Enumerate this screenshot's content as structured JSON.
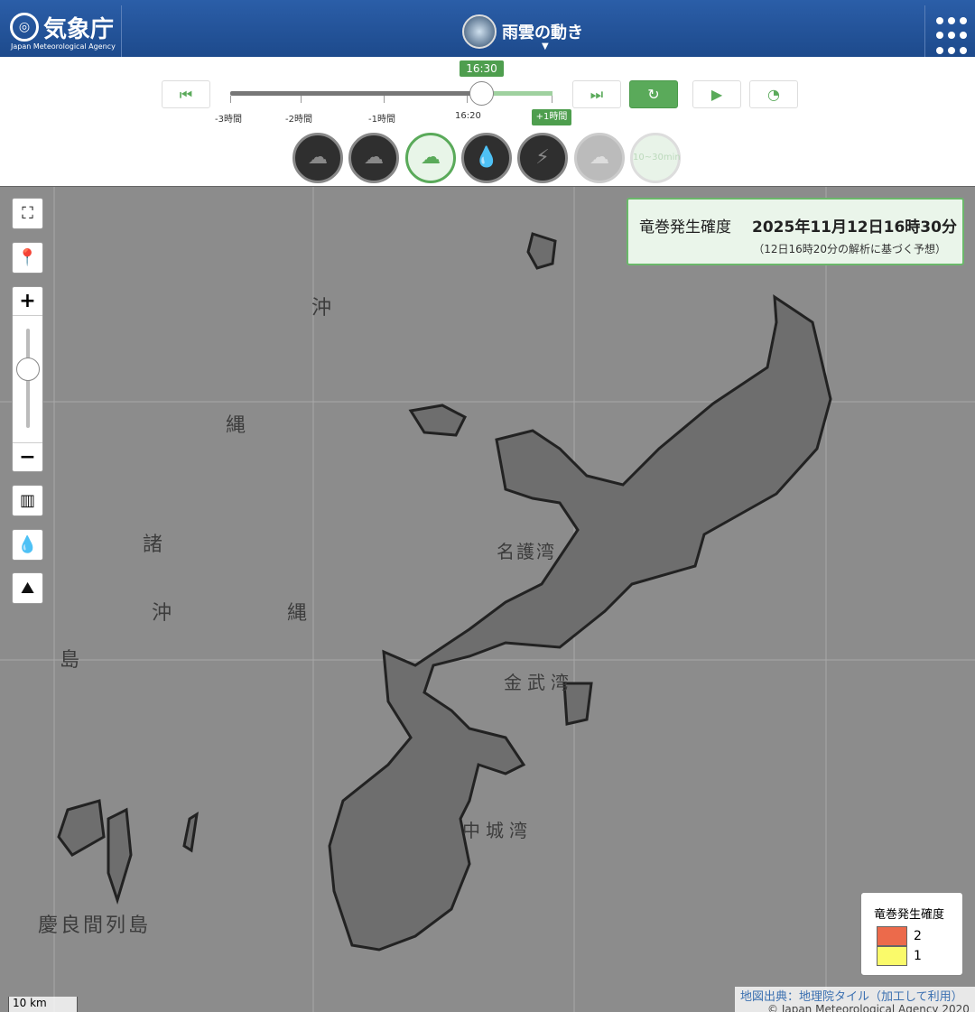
{
  "header": {
    "logo_jp": "気象庁",
    "logo_en": "Japan Meteorological Agency",
    "title": "雨雲の動き",
    "menu_icon": "grid-menu-icon"
  },
  "timeline": {
    "current_time": "16:30",
    "labels": [
      "-3時間",
      "-2時間",
      "-1時間",
      "16:20"
    ],
    "plus_label": "+1時間",
    "progress_fraction": 0.78
  },
  "layers": [
    {
      "name": "rain-cloud",
      "active": false
    },
    {
      "name": "thunder-cloud",
      "active": false
    },
    {
      "name": "tornado",
      "active": true
    },
    {
      "name": "rain-drop",
      "active": false
    },
    {
      "name": "lightning",
      "active": false
    },
    {
      "name": "heavy-rain",
      "active": false,
      "disabled": true
    },
    {
      "name": "10-30min",
      "label": "10~30min",
      "disabled": true
    }
  ],
  "info": {
    "element": "竜巻発生確度",
    "datetime": "2025年11月12日16時30分",
    "note": "（12日16時20分の解析に基づく予想）"
  },
  "legend": {
    "title": "竜巻発生確度",
    "items": [
      {
        "value": "2",
        "color": "#ec6a4b"
      },
      {
        "value": "1",
        "color": "#fafa6a"
      }
    ]
  },
  "map_labels": {
    "oki1": "沖",
    "nawa1": "縄",
    "sho": "諸",
    "oki2": "沖",
    "nawa2": "縄",
    "shima": "島",
    "nago": "名護湾",
    "kin": "金武湾",
    "nakagusuku": "中城湾",
    "kerama": "慶良間列島"
  },
  "attribution": {
    "source": "地図出典：地理院タイル（加工して利用）",
    "copyright": "© Japan Meteorological Agency 2020"
  },
  "scale": "10 km"
}
